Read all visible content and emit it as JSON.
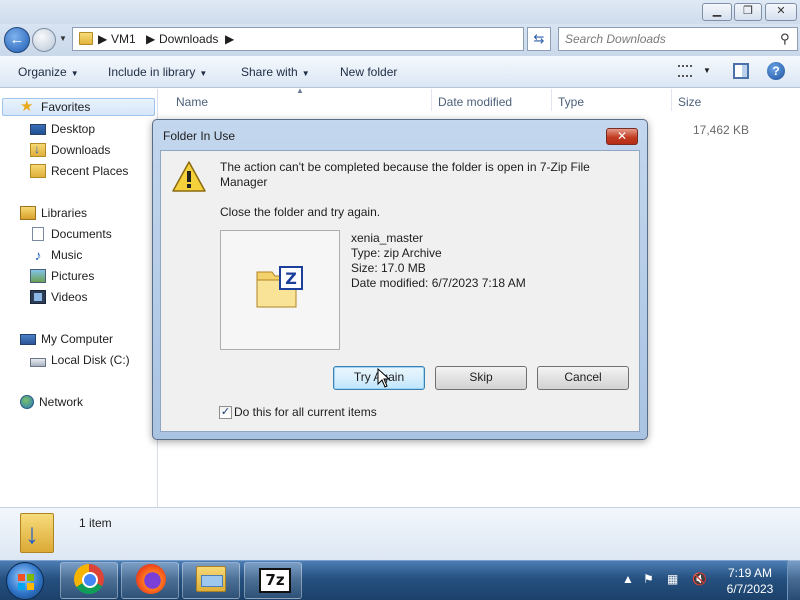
{
  "window": {
    "controls": [
      "minimize",
      "maximize",
      "close"
    ]
  },
  "address": {
    "crumbs": [
      "VM1",
      "Downloads"
    ],
    "search_placeholder": "Search Downloads"
  },
  "toolbar": {
    "organize": "Organize",
    "include_in_library": "Include in library",
    "share_with": "Share with",
    "new_folder": "New folder"
  },
  "nav": {
    "favorites": "Favorites",
    "desktop": "Desktop",
    "downloads": "Downloads",
    "recent_places": "Recent Places",
    "libraries": "Libraries",
    "documents": "Documents",
    "music": "Music",
    "pictures": "Pictures",
    "videos": "Videos",
    "my_computer": "My Computer",
    "local_disk": "Local Disk (C:)",
    "network": "Network"
  },
  "columns": {
    "name": "Name",
    "date_modified": "Date modified",
    "type": "Type",
    "size": "Size"
  },
  "files": [
    {
      "size": "17,462 KB"
    }
  ],
  "details": {
    "item_count": "1 item"
  },
  "dialog": {
    "title": "Folder In Use",
    "close_glyph": "✕",
    "message": "The action can't be completed because the folder is open in 7-Zip File Manager",
    "instruction": "Close the folder and try again.",
    "file": {
      "name": "xenia_master",
      "type": "Type: zip Archive",
      "size": "Size: 17.0 MB",
      "date_modified": "Date modified: 6/7/2023 7:18 AM"
    },
    "buttons": {
      "try_again": "Try Again",
      "skip": "Skip",
      "cancel": "Cancel"
    },
    "checkbox_label": "Do this for all current items",
    "checkbox_checked": true
  },
  "taskbar": {
    "apps": [
      "chrome-icon",
      "firefox-icon",
      "file-explorer-icon",
      "7zip-icon"
    ],
    "sevenzip_label": "7z",
    "clock_time": "7:19 AM",
    "clock_date": "6/7/2023"
  },
  "colors": {
    "accent": "#2b66c4",
    "taskbar": "#25507f",
    "dialog_frame": "#a9c3e2"
  }
}
